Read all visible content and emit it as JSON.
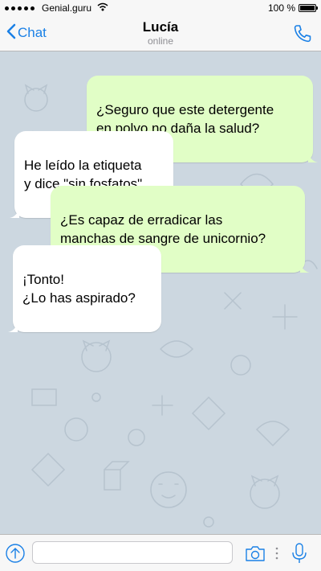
{
  "status_bar": {
    "carrier": "Genial.guru",
    "battery": "100 %",
    "battery_level": 1.0
  },
  "nav": {
    "back_label": "Chat",
    "title": "Lucía",
    "subtitle": "online"
  },
  "messages": [
    {
      "side": "out",
      "text": "¿Seguro que este detergente\nen polvo no daña la salud?"
    },
    {
      "side": "in",
      "text": "He leído la etiqueta\ny dice \"sin fosfatos\""
    },
    {
      "side": "out",
      "text": "¿Es capaz de erradicar las\nmanchas de sangre de unicornio?"
    },
    {
      "side": "in",
      "text": "¡Tonto!\n¿Lo has aspirado?"
    }
  ],
  "input": {
    "value": "",
    "placeholder": ""
  },
  "colors": {
    "accent": "#1a80e6",
    "outgoing_bubble": "#e1fec6",
    "incoming_bubble": "#ffffff",
    "chat_background": "#ccd7e0"
  },
  "icons": {
    "back": "chevron-left-icon",
    "call": "phone-icon",
    "attach": "upload-arrow-icon",
    "camera": "camera-icon",
    "mic": "microphone-icon"
  }
}
